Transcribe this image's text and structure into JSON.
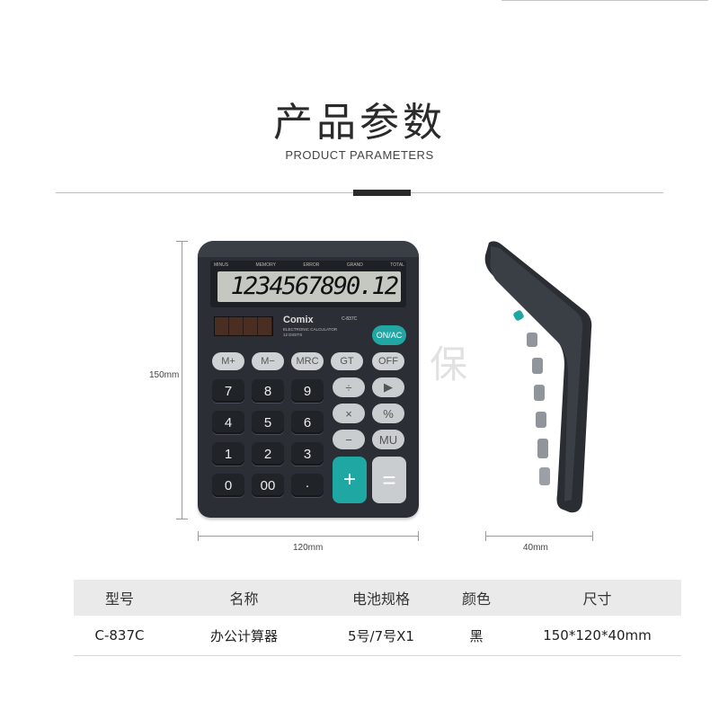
{
  "header": {
    "title": "产品参数",
    "subtitle": "PRODUCT PARAMETERS"
  },
  "dimensions": {
    "height_label": "150mm",
    "width_label": "120mm",
    "depth_label": "40mm"
  },
  "calculator": {
    "lcd_labels": [
      "MINUS",
      "MEMORY",
      "ERROR",
      "GRAND",
      "TOTAL"
    ],
    "display": "1234567890.12",
    "brand": "Comix",
    "model": "C-837C",
    "subbrand_line1": "ELECTRONIC CALCULATOR",
    "subbrand_line2": "12 DIGITS",
    "keys": {
      "on_ac": "ON/AC",
      "m_plus": "M+",
      "m_minus": "M−",
      "mrc": "MRC",
      "gt": "GT",
      "off": "OFF",
      "seven": "7",
      "eight": "8",
      "nine": "9",
      "four": "4",
      "five": "5",
      "six": "6",
      "one": "1",
      "two": "2",
      "three": "3",
      "zero": "0",
      "double_zero": "00",
      "dot": "·",
      "divide": "÷",
      "arrow": "▶",
      "multiply": "×",
      "percent": "%",
      "minus": "−",
      "mu": "MU",
      "plus": "+",
      "equals": "="
    }
  },
  "watermark": "保",
  "spec_table": {
    "headers": [
      "型号",
      "名称",
      "电池规格",
      "颜色",
      "尺寸"
    ],
    "row": [
      "C-837C",
      "办公计算器",
      "5号/7号X1",
      "黑",
      "150*120*40mm"
    ]
  },
  "colors": {
    "accent_teal": "#1fa7a3",
    "body": "#2b2f35"
  }
}
